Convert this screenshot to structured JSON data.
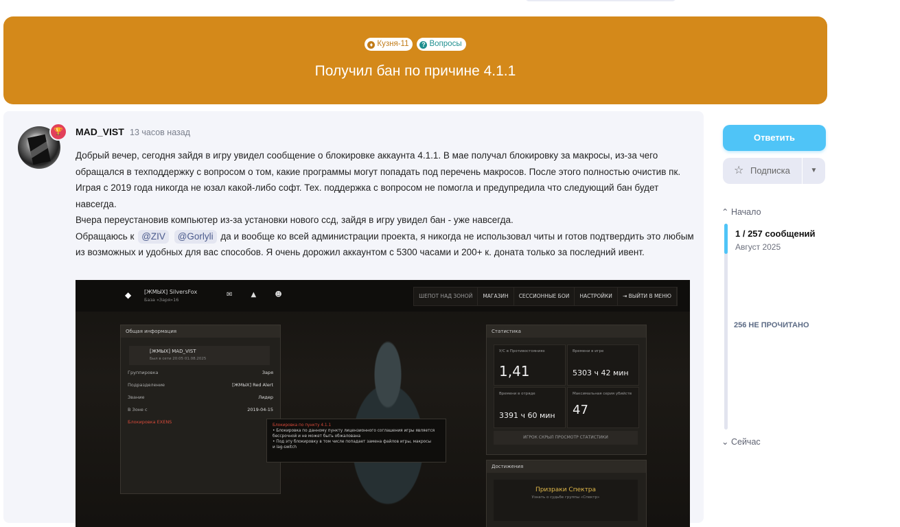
{
  "banner": {
    "tags": [
      {
        "icon": "trophy-icon",
        "label": "Кузня-11",
        "color": "#c17b18"
      },
      {
        "icon": "question-icon",
        "label": "Вопросы",
        "color": "#1f8f8f"
      }
    ],
    "title": "Получил бан по причине 4.1.1",
    "bg_color": "#d4891a"
  },
  "post": {
    "author": "MAD_VIST",
    "time": "13 часов назад",
    "p1": "Добрый вечер, сегодня зайдя в игру увидел сообщение о блокировке аккаунта 4.1.1. В мае получал блокировку за макросы, из-за чего обращался в техподдержку с вопросом о том, какие программы могут попадать под перечень макросов. После этого полностью очистив пк. Играя с 2019 года никогда не юзал какой-либо софт. Тех. поддержка с вопросом не помогла и предупредила что следующий бан будет навсегда.",
    "p2": "Вчера переустановив компьютер из-за установки нового ссд, зайдя в игру увидел бан - уже навсегда.",
    "p3_before": "Обращаюсь к",
    "mention1": "@ZIV",
    "mention2": "@Gorlyli",
    "p3_after": "да и вообще ко всей администрации проекта, я никогда не использовал читы и готов подтвердить это любым из возможных и удобных для вас способов. Я очень дорожил аккаунтом с 5300 часами и 200+ к. доната только за последний ивент."
  },
  "screenshot": {
    "player": "[ЖМЫХ] SilversFox",
    "player_sub": "База «Заря»16",
    "menu": [
      "ШЕПОТ НАД ЗОНОЙ",
      "МАГАЗИН",
      "СЕССИОННЫЕ БОИ",
      "НАСТРОЙКИ",
      "⇥ ВЫЙТИ В МЕНЮ"
    ],
    "general_title": "Общая информация",
    "profile_name": "[ЖМЫХ] MAD_VIST",
    "profile_sub": "Был в сети 20:05 01.08.2025",
    "rows": [
      {
        "k": "Группировка",
        "v": "Заря"
      },
      {
        "k": "Подразделение",
        "v": "[ЖМЫХ] Red Alert"
      },
      {
        "k": "Звание",
        "v": "Лидер"
      },
      {
        "k": "В Зоне с",
        "v": "2019-04-15"
      }
    ],
    "ban_label": "Блокировка EXENS",
    "stats_title": "Статистика",
    "stats": [
      {
        "label": "У/С в Противостояниях",
        "value": "1,41"
      },
      {
        "label": "Времени в игре",
        "value": "5303 ч 42 мин"
      },
      {
        "label": "Времени в отряде",
        "value": "3391 ч 60 мин"
      },
      {
        "label": "Максимальная серия убийств",
        "value": "47"
      }
    ],
    "stats_hidden": "ИГРОК СКРЫЛ ПРОСМОТР СТАТИСТИКИ",
    "achievements_title": "Достижения",
    "achievement": "Призраки Спектра",
    "achievement_sub": "Узнать о судьбе группы «Спектр»",
    "tooltip": [
      "Блокировка по пункту 4.1.1",
      "• Блокировка по данному пункту лицензионного соглашения игры является",
      "  бессрочной и не может быть обжалована",
      "• Под эту блокировку в том числе попадает замена файлов игры, макросы",
      "  и lag-switch"
    ]
  },
  "sidebar": {
    "reply": "Ответить",
    "subscribe": "Подписка",
    "nav_start": "Начало",
    "position": "1 / 257 сообщений",
    "date": "Август 2025",
    "unread": "256 НЕ ПРОЧИТАНО",
    "nav_now": "Сейчас",
    "accent": "#4fc4f7"
  }
}
